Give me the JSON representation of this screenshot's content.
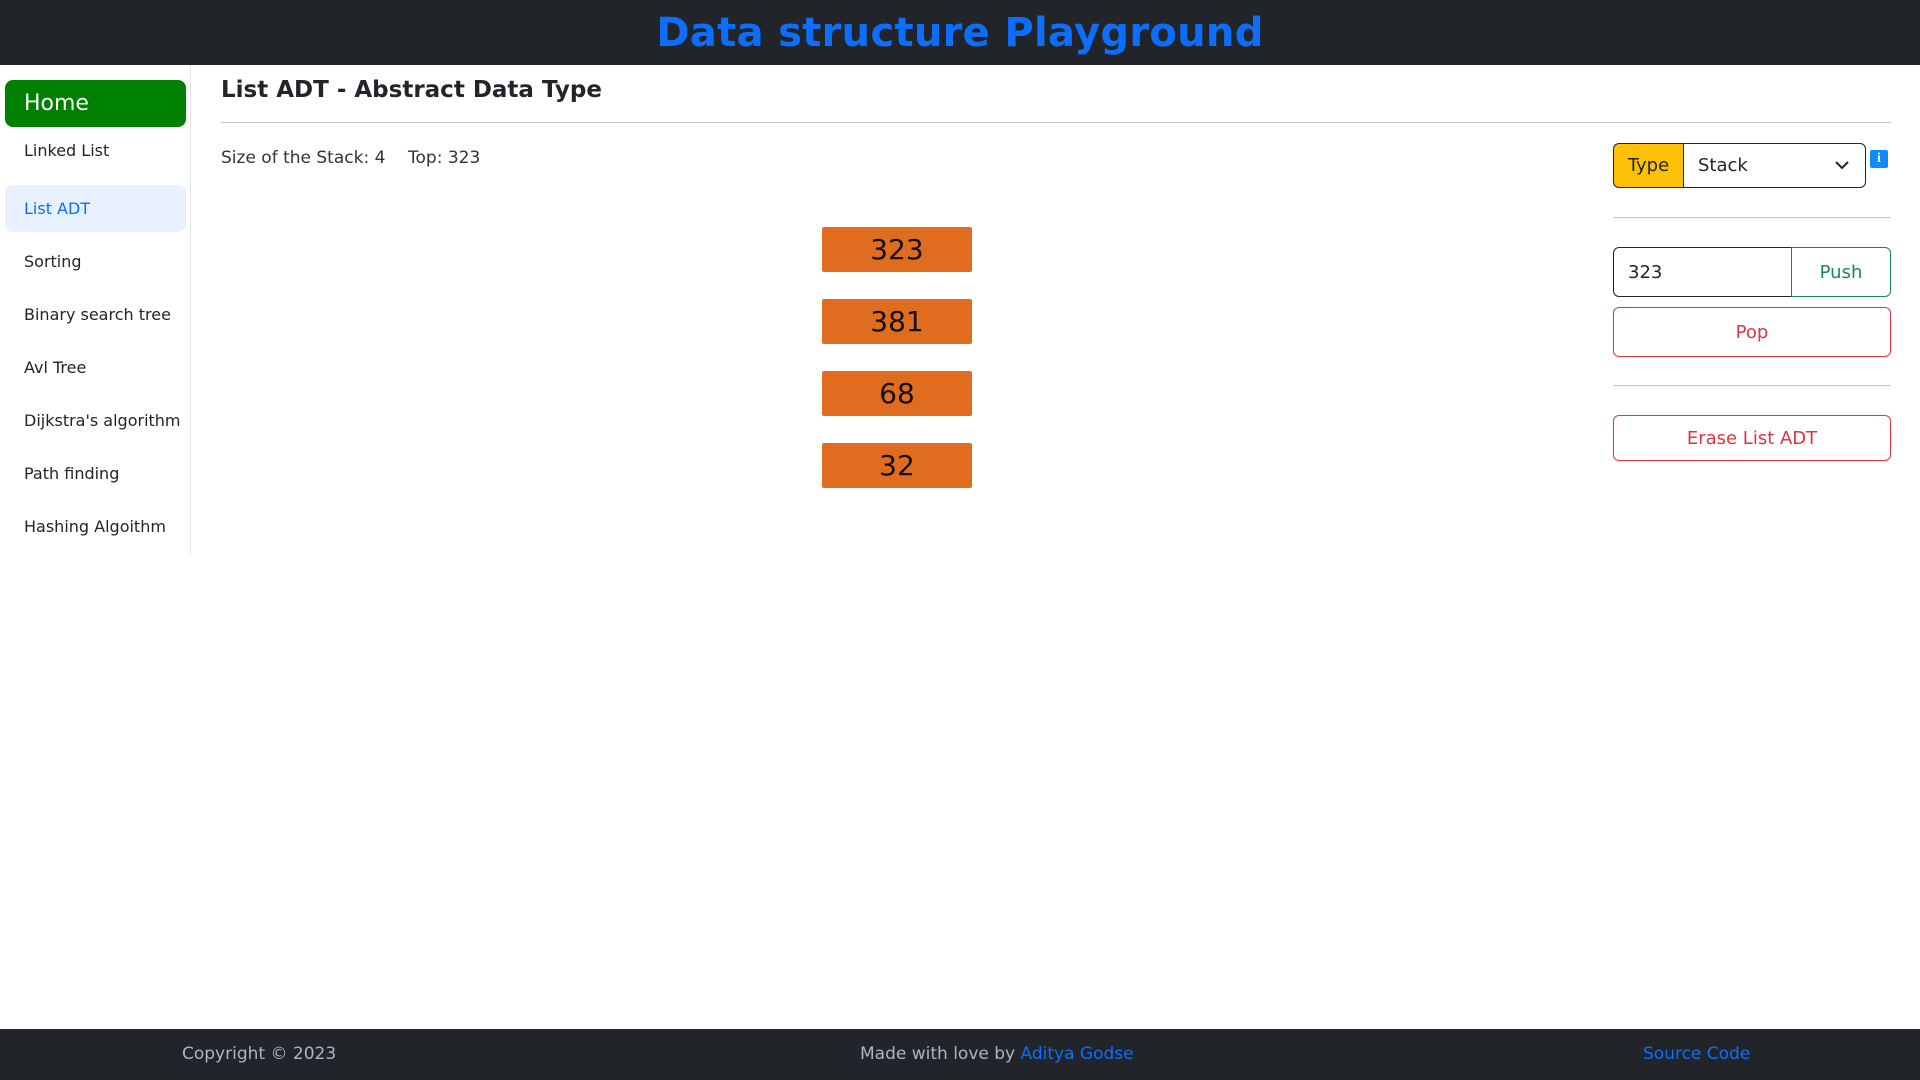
{
  "header": {
    "title": "Data structure Playground"
  },
  "sidebar": {
    "home_label": "Home",
    "items": [
      {
        "label": "Linked List"
      },
      {
        "label": "List ADT",
        "active": true
      },
      {
        "label": "Sorting"
      },
      {
        "label": "Binary search tree"
      },
      {
        "label": "Avl Tree"
      },
      {
        "label": "Dijkstra's algorithm"
      },
      {
        "label": "Path finding"
      },
      {
        "label": "Hashing Algoithm"
      }
    ]
  },
  "main": {
    "title": "List ADT - Abstract Data Type",
    "size_text": "Size of the Stack: 4",
    "top_text": "Top: 323",
    "stack": [
      "323",
      "381",
      "68",
      "32"
    ]
  },
  "panel": {
    "type_label": "Type",
    "type_selected": "Stack",
    "info_icon": "i",
    "input_value": "323",
    "push_label": "Push",
    "pop_label": "Pop",
    "erase_label": "Erase List ADT"
  },
  "footer": {
    "copyright": "Copyright © 2023",
    "made_with_prefix": "Made with love by ",
    "author": "Aditya Godse",
    "source": "Source Code"
  },
  "colors": {
    "header_bg": "#212529",
    "accent_blue": "#0d6efd",
    "home_green": "#008000",
    "stack_orange": "#e06c20",
    "type_yellow": "#ffc107",
    "danger_red": "#dc3545",
    "success_green": "#198754"
  }
}
